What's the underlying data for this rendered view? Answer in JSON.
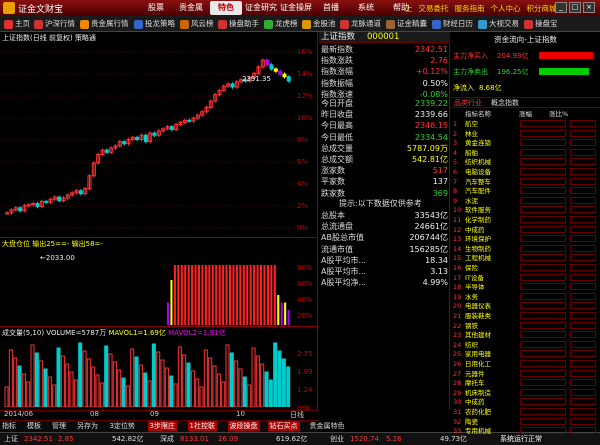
{
  "app": {
    "title": "证金文财宝"
  },
  "menu_tabs": [
    "股票",
    "贵金属",
    "特色",
    "证金研究",
    "证金操屏",
    "首播",
    "系统",
    "帮助"
  ],
  "menu_active": "特色",
  "title_links": [
    "上",
    "交易委托",
    "服务指南",
    "个人中心",
    "积分商城"
  ],
  "toolbar": [
    {
      "label": "主页",
      "color": "#d33"
    },
    {
      "label": "沪深行情",
      "color": "#c33"
    },
    {
      "label": "贵金属行情",
      "color": "#e80"
    },
    {
      "label": "投龙策略",
      "color": "#36c"
    },
    {
      "label": "风云榜",
      "color": "#c60"
    },
    {
      "label": "操盘助手",
      "color": "#c33"
    },
    {
      "label": "龙虎榜",
      "color": "#3a3"
    },
    {
      "label": "金股池",
      "color": "#d90"
    },
    {
      "label": "龙脉通道",
      "color": "#c33"
    },
    {
      "label": "证金精囊",
      "color": "#963"
    },
    {
      "label": "财经日历",
      "color": "#36c"
    },
    {
      "label": "大视交易",
      "color": "#39c"
    },
    {
      "label": "操盘宝",
      "color": "#c33"
    }
  ],
  "chart": {
    "header": "上证指数(日线 前复权) 策略通",
    "high_label": "2391.35",
    "low_label": "2033.00",
    "pct_ticks": [
      "16%",
      "14%",
      "12%",
      "10%",
      "8%",
      "6%",
      "4%",
      "2%",
      "0%"
    ],
    "indicator_header": "大盘仓位 输出25==- 输出58=-",
    "indicator_ticks": [
      "80%",
      "60%",
      "40%",
      "20%"
    ],
    "volume_header_a": "成交量(5,10) VOLUME=5787万",
    "volume_header_b": "MAVOL1=1.69亿",
    "volume_header_c": "MAVOL2=1.91亿",
    "volume_ticks": [
      "2.75",
      "1.99",
      "1.24"
    ],
    "volume_unit": "亿股",
    "date_labels": [
      "2014/06",
      "08",
      "09",
      "10"
    ],
    "date_right": "日线"
  },
  "chart_data": {
    "type": "bar",
    "close": [
      2033,
      2040,
      2045,
      2038,
      2050,
      2052,
      2055,
      2048,
      2060,
      2058,
      2065,
      2070,
      2062,
      2068,
      2075,
      2080,
      2085,
      2078,
      2090,
      2120,
      2150,
      2170,
      2180,
      2175,
      2185,
      2190,
      2200,
      2195,
      2205,
      2210,
      2205,
      2215,
      2200,
      2220,
      2215,
      2225,
      2230,
      2235,
      2228,
      2240,
      2245,
      2250,
      2248,
      2255,
      2262,
      2270,
      2280,
      2295,
      2310,
      2320,
      2330,
      2335,
      2328,
      2340,
      2345,
      2342,
      2350,
      2360,
      2375,
      2391,
      2380,
      2370,
      2365,
      2358,
      2352,
      2342
    ],
    "position_pct": [
      0,
      0,
      0,
      0,
      0,
      0,
      0,
      0,
      0,
      0,
      0,
      0,
      0,
      0,
      0,
      0,
      0,
      0,
      0,
      0,
      0,
      0,
      0,
      0,
      0,
      0,
      0,
      0,
      0,
      0,
      0,
      0,
      0,
      0,
      0,
      0,
      0,
      0,
      0,
      0,
      0,
      0,
      0,
      0,
      0,
      0,
      0,
      30,
      60,
      80,
      80,
      80,
      80,
      80,
      80,
      80,
      80,
      80,
      80,
      80,
      80,
      80,
      80,
      80,
      80,
      80,
      80,
      80,
      80,
      80,
      80,
      80,
      80,
      80,
      80,
      80,
      80,
      80,
      80,
      40,
      30,
      30,
      20
    ]
  },
  "quote": {
    "name_label": "上证指数",
    "code": "000001",
    "rows": [
      {
        "k": "最新指数",
        "v": "2342.51",
        "c": "#f33"
      },
      {
        "k": "指数涨跌",
        "v": "2.76",
        "c": "#f33"
      },
      {
        "k": "指数涨幅",
        "v": "+0.12%",
        "c": "#f33"
      },
      {
        "k": "指数振幅",
        "v": "0.50%",
        "c": "#eee"
      },
      {
        "k": "指数涨速",
        "v": "-0.08%",
        "c": "#3c3"
      }
    ],
    "rows2": [
      {
        "k": "今日开盘",
        "v": "2339.22",
        "c": "#3c3"
      },
      {
        "k": "昨日收盘",
        "v": "2339.66",
        "c": "#eee"
      },
      {
        "k": "今日最高",
        "v": "2346.15",
        "c": "#f33"
      },
      {
        "k": "今日最低",
        "v": "2334.54",
        "c": "#3c3"
      },
      {
        "k": "总成交量",
        "v": "5787.09万",
        "c": "#ff0"
      },
      {
        "k": "总成交额",
        "v": "542.81亿",
        "c": "#ff0"
      },
      {
        "k": "涨家数",
        "v": "517",
        "c": "#f33"
      },
      {
        "k": "平家数",
        "v": "137",
        "c": "#eee"
      },
      {
        "k": "跌家数",
        "v": "369",
        "c": "#3c3"
      }
    ],
    "notice": "提示:以下数据仅供参考",
    "rows3": [
      {
        "k": "总股本",
        "v": "33543亿"
      },
      {
        "k": "总流通盘",
        "v": "24661亿"
      },
      {
        "k": "AB股总市值",
        "v": "206744亿"
      },
      {
        "k": "流通市值",
        "v": "156285亿"
      },
      {
        "k": "A股平均市...",
        "v": "18.34"
      },
      {
        "k": "A股平均市...",
        "v": "3.13"
      },
      {
        "k": "A股平均净...",
        "v": "4.99%"
      }
    ]
  },
  "fund": {
    "title": "资金流向-上证指数",
    "inflow_label": "主力净买入",
    "inflow_value": "204.93亿",
    "outflow_label": "主力净卖出",
    "outflow_value": "196.25亿",
    "net_label": "净流入",
    "net_value": "8.68亿",
    "tabs": [
      "品类行业",
      "概念指数"
    ],
    "col_headers": [
      "",
      "指标名称",
      "涨幅",
      "涨比%"
    ],
    "sectors": [
      "航空",
      "林业",
      "黄金连锁",
      "船舶",
      "纺织机械",
      "电脑设备",
      "汽车整车",
      "汽车配件",
      "水泥",
      "软件服务",
      "化学制药",
      "中成药",
      "环境保护",
      "生物制药",
      "工程机械",
      "保险",
      "IT设备",
      "半导体",
      "水务",
      "电器仪表",
      "服装鞋类",
      "钢铁",
      "其他建材",
      "纺织",
      "家用电器",
      "日用化工",
      "元器件",
      "摩托车",
      "机床制造",
      "中成药",
      "农药化肥",
      "陶瓷",
      "专用机械"
    ]
  },
  "bottom_tabs": [
    "指标",
    "模板",
    "管理",
    "另存为",
    "3定位势",
    "3步限庄",
    "1社控联",
    "波段操盘",
    "钻石买点",
    "贵金属特色"
  ],
  "status": {
    "sh_label": "上证",
    "sh_value": "2342.51",
    "sh_change": "2.85",
    "sh_amount": "542.82亿",
    "sz_label": "深成",
    "sz_value": "8133.01",
    "sz_change": "26.09",
    "sz_amount": "619.62亿",
    "cy_label": "创业",
    "cy_value": "1520.74",
    "cy_change": "5.26",
    "cy_amount": "49.73亿",
    "running": "系统运行正常"
  }
}
